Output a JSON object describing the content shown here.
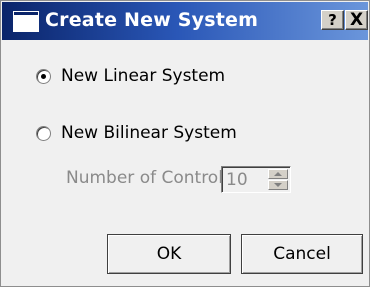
{
  "window": {
    "title": "Create New System",
    "help_glyph": "?",
    "close_glyph": "X"
  },
  "options": {
    "linear_label": "New Linear System",
    "bilinear_label": "New Bilinear System",
    "selected": "linear"
  },
  "controls": {
    "label": "Number of Controls",
    "value": "10",
    "enabled": false
  },
  "buttons": {
    "ok_label": "OK",
    "cancel_label": "Cancel"
  },
  "colors": {
    "titlebar_start": "#0a246a",
    "titlebar_end": "#6b96db",
    "dialog_bg": "#f0f0f0",
    "disabled_text": "#8a8a8a"
  },
  "icons": {
    "title": "window-icon",
    "help": "question-mark-icon",
    "close": "close-icon"
  }
}
